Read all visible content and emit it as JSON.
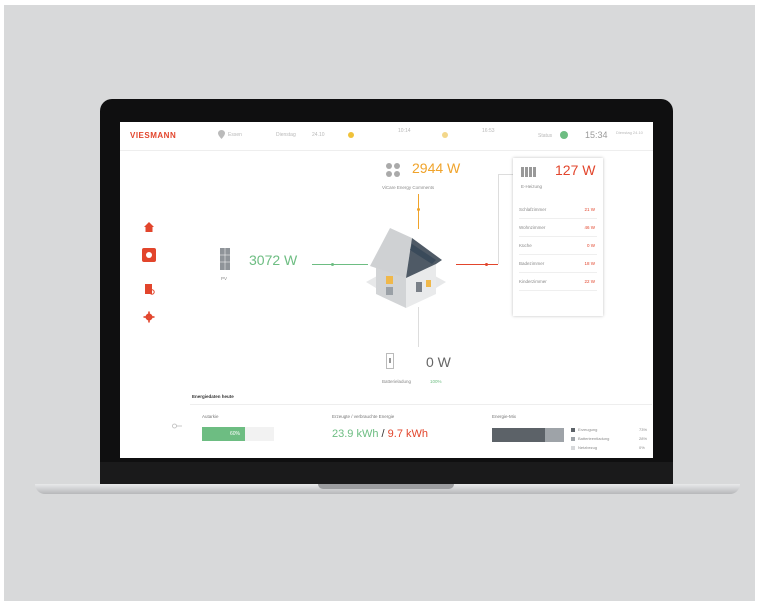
{
  "brand": {
    "logo_text": "VIESMANN",
    "accent": "#e2452c",
    "green": "#6dbd82",
    "orange": "#f0a32a"
  },
  "topbar": {
    "location": "Essen",
    "weekday": "Dienstag",
    "date": "24.10",
    "weather_1": "10:14",
    "weather_2": "16:53",
    "status_label": "Status",
    "time": "15:34",
    "time_sub": "Dienstag 24.10"
  },
  "sidebar": {
    "items": [
      {
        "name": "home"
      },
      {
        "name": "energy",
        "active": true
      },
      {
        "name": "report"
      },
      {
        "name": "settings"
      }
    ]
  },
  "flows": {
    "heatpump": {
      "value": "2944 W",
      "label": "ViCare Energy Comments"
    },
    "pv": {
      "value": "3072 W",
      "label": "PV"
    },
    "battery": {
      "value": "0 W",
      "label": "Batterieladung",
      "charge": "100%"
    },
    "heating": {
      "value": "127 W",
      "label": "E-Heizung"
    }
  },
  "rooms": [
    {
      "name": "Schlafzimmer",
      "value": "21 W"
    },
    {
      "name": "Wohnzimmer",
      "value": "46 W"
    },
    {
      "name": "Küche",
      "value": "0 W"
    },
    {
      "name": "Badezimmer",
      "value": "18 W"
    },
    {
      "name": "Kinderzimmer",
      "value": "22 W"
    }
  ],
  "today": {
    "title": "Energiedaten heute",
    "autarky_label": "Autarkie",
    "autarky_value": "60%",
    "autarky_fraction": 0.6,
    "energy_label": "Erzeugte / verbrauchte Energie",
    "generated": "23.9 kWh",
    "separator": "/",
    "consumed": "9.7 kWh",
    "mix_label": "Energie-Mix",
    "mix": [
      {
        "name": "Erzeugung",
        "percent": "73%",
        "fraction": 0.73,
        "color": "#5c6268"
      },
      {
        "name": "Batterieentladung",
        "percent": "28%",
        "fraction": 0.28,
        "color": "#9ea3a8"
      },
      {
        "name": "Netzbezug",
        "percent": "0%",
        "fraction": 0.0,
        "color": "#d6d8da"
      }
    ]
  }
}
